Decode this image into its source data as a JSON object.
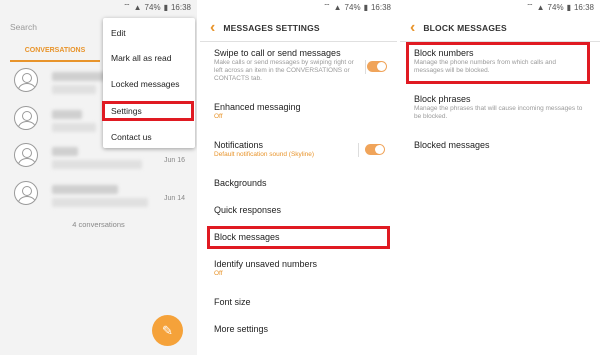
{
  "status": {
    "signal": "74%",
    "time": "16:38"
  },
  "panel1": {
    "search_placeholder": "Search",
    "tab": "CONVERSATIONS",
    "conversations": [
      {
        "date": ""
      },
      {
        "date": ""
      },
      {
        "date": "Jun 16"
      },
      {
        "date": "Jun 14"
      }
    ],
    "count": "4 conversations",
    "menu": [
      "Edit",
      "Mark all as read",
      "Locked messages",
      "Settings",
      "Contact us"
    ]
  },
  "panel2": {
    "title": "MESSAGES SETTINGS",
    "items": [
      {
        "title": "Swipe to call or send messages",
        "sub": "Make calls or send messages by swiping right or left across an item in the CONVERSATIONS or CONTACTS tab."
      },
      {
        "title": "Enhanced messaging",
        "sub": "Off"
      },
      {
        "title": "Notifications",
        "sub": "Default notification sound (Skyline)"
      },
      {
        "title": "Backgrounds",
        "sub": ""
      },
      {
        "title": "Quick responses",
        "sub": ""
      },
      {
        "title": "Block messages",
        "sub": ""
      },
      {
        "title": "Identify unsaved numbers",
        "sub": "Off"
      },
      {
        "title": "Font size",
        "sub": ""
      },
      {
        "title": "More settings",
        "sub": ""
      }
    ]
  },
  "panel3": {
    "title": "BLOCK MESSAGES",
    "items": [
      {
        "title": "Block numbers",
        "sub": "Manage the phone numbers from which calls and messages will be blocked."
      },
      {
        "title": "Block phrases",
        "sub": "Manage the phrases that will cause incoming messages to be blocked."
      },
      {
        "title": "Blocked messages",
        "sub": ""
      }
    ]
  }
}
